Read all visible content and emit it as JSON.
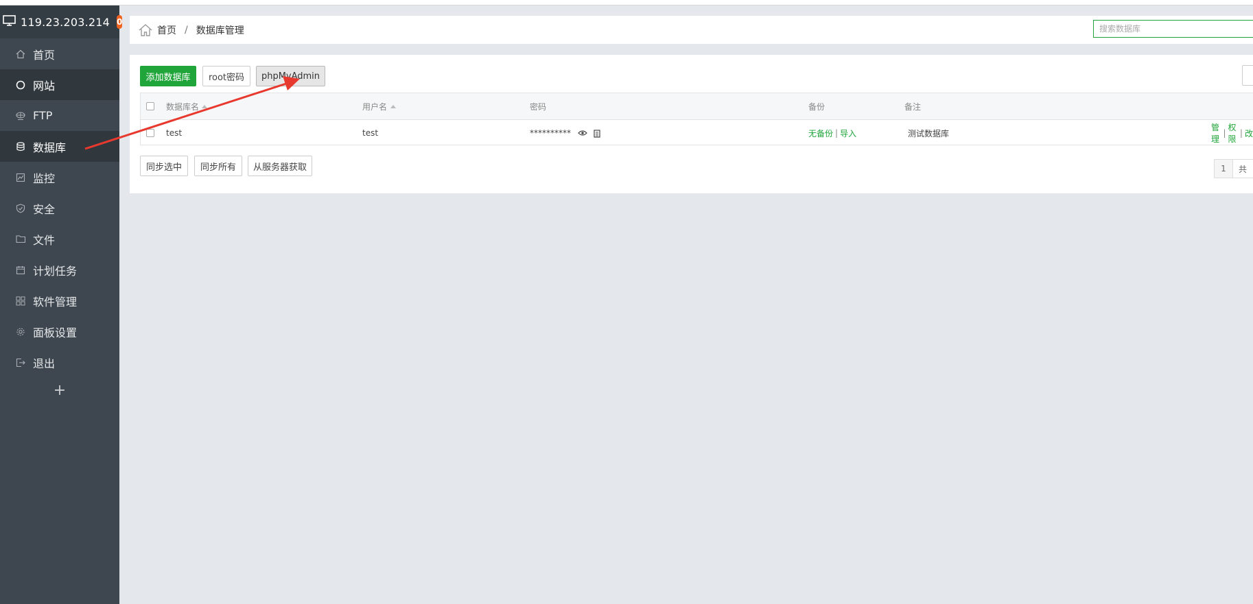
{
  "sidebar": {
    "server_ip": "119.23.203.214",
    "badge_count": "0",
    "items": [
      {
        "label": "首页",
        "icon": "home-icon"
      },
      {
        "label": "网站",
        "icon": "globe-icon"
      },
      {
        "label": "FTP",
        "icon": "ftp-icon"
      },
      {
        "label": "数据库",
        "icon": "database-icon"
      },
      {
        "label": "监控",
        "icon": "monitor-chart-icon"
      },
      {
        "label": "安全",
        "icon": "shield-icon"
      },
      {
        "label": "文件",
        "icon": "folder-icon"
      },
      {
        "label": "计划任务",
        "icon": "calendar-icon"
      },
      {
        "label": "软件管理",
        "icon": "grid-icon"
      },
      {
        "label": "面板设置",
        "icon": "gear-icon"
      },
      {
        "label": "退出",
        "icon": "logout-icon"
      }
    ],
    "add_label": "+"
  },
  "breadcrumb": {
    "home": "首页",
    "separator": "/",
    "current": "数据库管理",
    "search_placeholder": "搜索数据库"
  },
  "toolbar": {
    "add_db": "添加数据库",
    "root_pwd": "root密码",
    "phpmyadmin": "phpMyAdmin"
  },
  "table": {
    "headers": {
      "name": "数据库名",
      "user": "用户名",
      "password": "密码",
      "backup": "备份",
      "remark": "备注"
    },
    "rows": [
      {
        "name": "test",
        "user": "test",
        "password": "**********",
        "backup_status": "无备份",
        "backup_sep": "|",
        "import": "导入",
        "remark": "测试数据库",
        "action_manage": "管理",
        "action_sep1": "|",
        "action_perm": "权限",
        "action_sep2": "|",
        "action_more": "改"
      }
    ]
  },
  "bottom": {
    "sync_selected": "同步选中",
    "sync_all": "同步所有",
    "fetch_server": "从服务器获取"
  },
  "pagination": {
    "page": "1",
    "total_prefix": "共"
  },
  "colors": {
    "accent": "#20a53a",
    "sidebar_bg": "#3e474f",
    "badge": "#f0641f",
    "annotation_arrow": "#e8392f"
  }
}
